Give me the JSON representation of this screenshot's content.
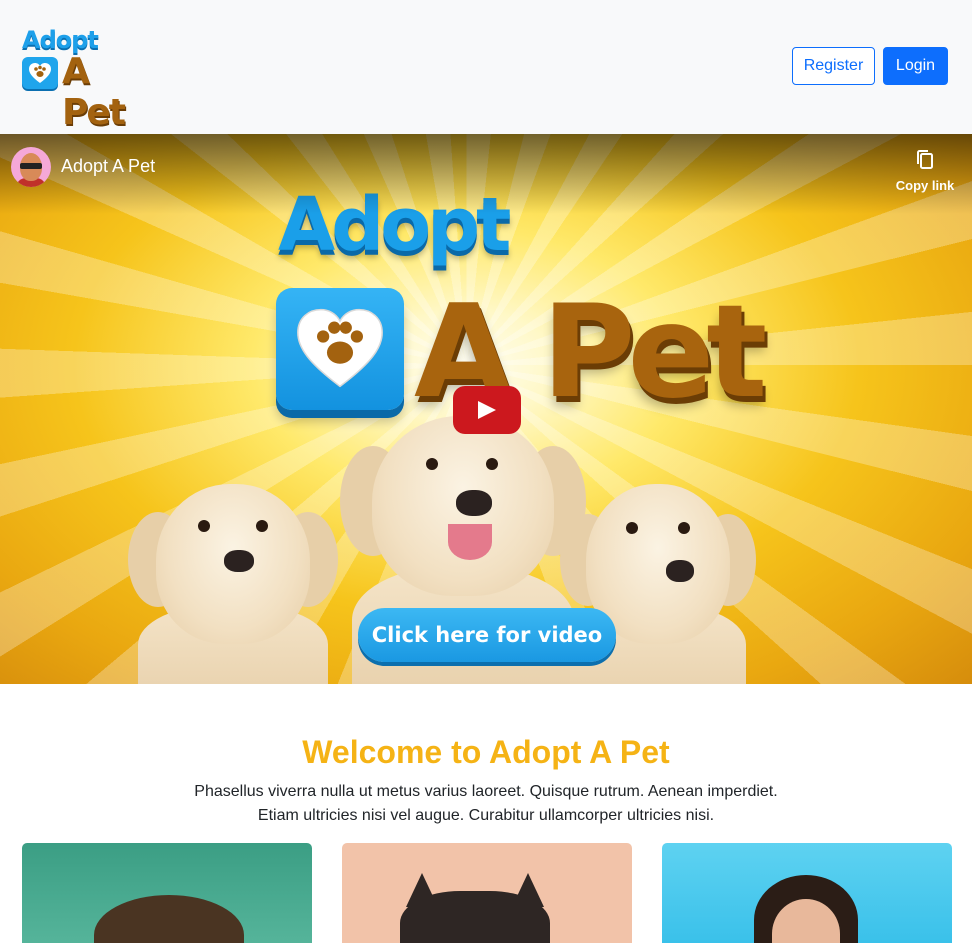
{
  "navbar": {
    "logo": {
      "line1": "Adopt",
      "line2": "A Pet"
    },
    "register_label": "Register",
    "login_label": "Login"
  },
  "video": {
    "channel_title": "Adopt A Pet",
    "copy_link_label": "Copy link",
    "thumb_line1": "Adopt",
    "thumb_line2": "A Pet",
    "cta_label": "Click here for video"
  },
  "welcome": {
    "title": "Welcome to Adopt A Pet",
    "text_line1": "Phasellus viverra nulla ut metus varius laoreet. Quisque rutrum. Aenean imperdiet.",
    "text_line2": "Etiam ultricies nisi vel augue. Curabitur ullamcorper ultricies nisi."
  },
  "colors": {
    "primary": "#0d6efd",
    "welcome_title": "#f5b315",
    "navbar_bg": "#f8f9fa",
    "play_red": "#cc181e"
  },
  "icons": [
    "paw-icon",
    "copy-icon",
    "play-icon"
  ]
}
